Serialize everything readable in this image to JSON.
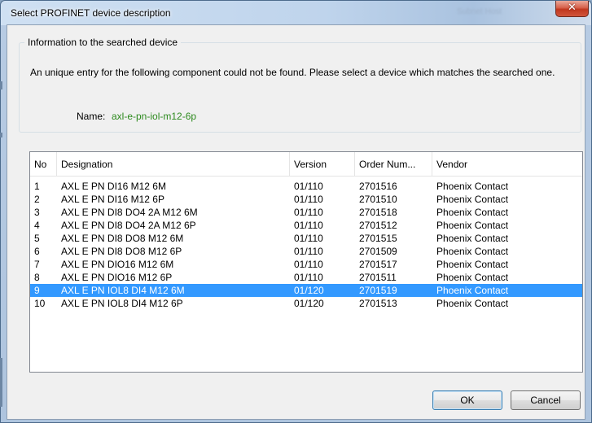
{
  "window": {
    "title": "Select PROFINET device description",
    "ghost_text": "Subnet Host",
    "close_glyph": "✕"
  },
  "info": {
    "group_label": "Information to the searched device",
    "message": "An unique entry for the following component could not be found. Please select a device which matches the searched one.",
    "name_label": "Name:",
    "name_value": "axl-e-pn-iol-m12-6p"
  },
  "table": {
    "columns": [
      "No",
      "Designation",
      "Version",
      "Order Num...",
      "Vendor"
    ],
    "rows": [
      [
        "1",
        "AXL E PN DI16 M12 6M",
        "01/110",
        "2701516",
        "Phoenix Contact"
      ],
      [
        "2",
        "AXL E PN DI16 M12 6P",
        "01/110",
        "2701510",
        "Phoenix Contact"
      ],
      [
        "3",
        "AXL E PN DI8 DO4 2A M12 6M",
        "01/110",
        "2701518",
        "Phoenix Contact"
      ],
      [
        "4",
        "AXL E PN DI8 DO4 2A M12 6P",
        "01/110",
        "2701512",
        "Phoenix Contact"
      ],
      [
        "5",
        "AXL E PN DI8 DO8 M12 6M",
        "01/110",
        "2701515",
        "Phoenix Contact"
      ],
      [
        "6",
        "AXL E PN DI8 DO8 M12 6P",
        "01/110",
        "2701509",
        "Phoenix Contact"
      ],
      [
        "7",
        "AXL E PN DIO16 M12 6M",
        "01/110",
        "2701517",
        "Phoenix Contact"
      ],
      [
        "8",
        "AXL E PN DIO16 M12 6P",
        "01/110",
        "2701511",
        "Phoenix Contact"
      ],
      [
        "9",
        "AXL E PN IOL8 DI4 M12 6M",
        "01/120",
        "2701519",
        "Phoenix Contact"
      ],
      [
        "10",
        "AXL E PN IOL8 DI4 M12 6P",
        "01/120",
        "2701513",
        "Phoenix Contact"
      ]
    ],
    "selected_row": "9"
  },
  "buttons": {
    "ok": "OK",
    "cancel": "Cancel"
  },
  "colors": {
    "selection": "#3399ff",
    "name_value": "#2d8a1e",
    "close_button": "#c7432f"
  }
}
